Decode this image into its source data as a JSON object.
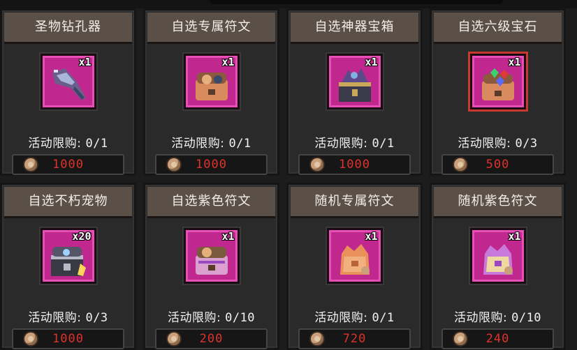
{
  "shop": {
    "items": [
      {
        "name": "圣物钻孔器",
        "qty": "x1",
        "limit_label": "活动限购:",
        "limit_value": "0/1",
        "price": "1000",
        "icon": "drill-icon",
        "frame": "magenta"
      },
      {
        "name": "自选专属符文",
        "qty": "x1",
        "limit_label": "活动限购:",
        "limit_value": "0/1",
        "price": "1000",
        "icon": "rune-chest-icon",
        "frame": "magenta"
      },
      {
        "name": "自选神器宝箱",
        "qty": "x1",
        "limit_label": "活动限购:",
        "limit_value": "0/1",
        "price": "1000",
        "icon": "artifact-chest-icon",
        "frame": "magenta"
      },
      {
        "name": "自选六级宝石",
        "qty": "x1",
        "limit_label": "活动限购:",
        "limit_value": "0/3",
        "price": "500",
        "icon": "gem-chest-icon",
        "frame": "red"
      },
      {
        "name": "自选不朽宠物",
        "qty": "x20",
        "limit_label": "活动限购:",
        "limit_value": "0/3",
        "price": "1000",
        "icon": "pet-chest-icon",
        "frame": "magenta"
      },
      {
        "name": "自选紫色符文",
        "qty": "x1",
        "limit_label": "活动限购:",
        "limit_value": "0/10",
        "price": "200",
        "icon": "purple-rune-chest-icon",
        "frame": "magenta"
      },
      {
        "name": "随机专属符文",
        "qty": "x1",
        "limit_label": "活动限购:",
        "limit_value": "0/1",
        "price": "720",
        "icon": "random-rune-bag-icon",
        "frame": "magenta"
      },
      {
        "name": "随机紫色符文",
        "qty": "x1",
        "limit_label": "活动限购:",
        "limit_value": "0/10",
        "price": "240",
        "icon": "random-purple-rune-bag-icon",
        "frame": "magenta"
      }
    ]
  },
  "colors": {
    "title_bar": "#5a5047",
    "card_bg": "#2a2a2a",
    "slot_magenta": "#c1288f",
    "slot_red_border": "#c83a2e",
    "price_red": "#e0322d"
  }
}
